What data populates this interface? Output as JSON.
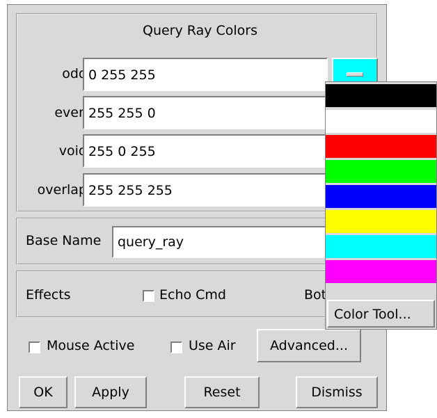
{
  "query_ray_colors": {
    "title": "Query Ray Colors",
    "rows": [
      {
        "label": "odd",
        "value": "0 255 255"
      },
      {
        "label": "even",
        "value": "255 255 0"
      },
      {
        "label": "void",
        "value": "255 0 255"
      },
      {
        "label": "overlap",
        "value": "255 255 255"
      }
    ],
    "odd_swatch_color": "#00ffff"
  },
  "base_name": {
    "label": "Base Name",
    "value": "query_ray"
  },
  "effects": {
    "label": "Effects",
    "echo_cmd_label": "Echo Cmd",
    "echo_cmd_checked": false,
    "truncated_label": "Bot"
  },
  "options": {
    "mouse_active_label": "Mouse Active",
    "mouse_active_checked": false,
    "use_air_label": "Use Air",
    "use_air_checked": false,
    "advanced_label": "Advanced..."
  },
  "buttons": {
    "ok": "OK",
    "apply": "Apply",
    "reset": "Reset",
    "dismiss": "Dismiss"
  },
  "color_popup": {
    "swatches": [
      {
        "name": "black",
        "color": "#000000"
      },
      {
        "name": "white",
        "color": "#ffffff"
      },
      {
        "name": "red",
        "color": "#ff0000"
      },
      {
        "name": "green",
        "color": "#00ff00"
      },
      {
        "name": "blue",
        "color": "#0000ff"
      },
      {
        "name": "yellow",
        "color": "#ffff00"
      },
      {
        "name": "cyan",
        "color": "#00ffff"
      },
      {
        "name": "magenta",
        "color": "#ff00ff"
      }
    ],
    "color_tool_label": "Color Tool..."
  }
}
